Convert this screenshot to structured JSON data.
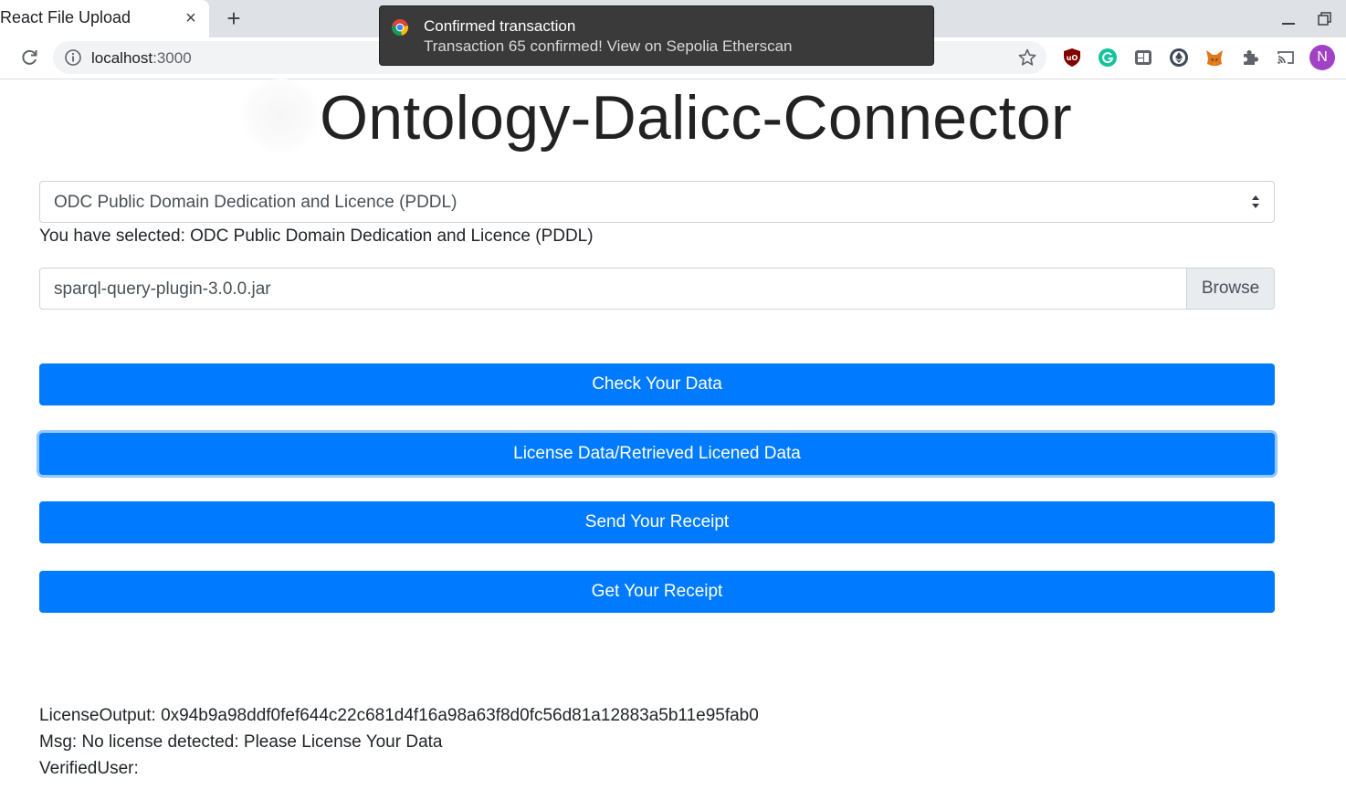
{
  "browser": {
    "tab_title": "React File Upload",
    "tab_close": "×",
    "new_tab": "+",
    "url_host": "localhost",
    "url_port": ":3000",
    "profile_initial": "N",
    "profile_color": "#a142c4",
    "extensions": [
      "ublock-icon",
      "grammarly-icon",
      "extension-icon",
      "ethereum-icon",
      "metamask-icon",
      "puzzle-icon",
      "cast-icon"
    ]
  },
  "toast": {
    "title": "Confirmed transaction",
    "body": "Transaction 65 confirmed! View on Sepolia Etherscan"
  },
  "page": {
    "title": "Ontology-Dalicc-Connector",
    "license_select": {
      "selected": "ODC Public Domain Dedication and Licence (PDDL)"
    },
    "selected_prefix": "You have selected: ",
    "selected_value": "ODC Public Domain Dedication and Licence (PDDL)",
    "file_input": {
      "file_name": "sparql-query-plugin-3.0.0.jar",
      "browse_label": "Browse"
    },
    "buttons": {
      "check": "Check Your Data",
      "license": "License Data/Retrieved Licened Data",
      "send_receipt": "Send Your Receipt",
      "get_receipt": "Get Your Receipt"
    },
    "output": {
      "license_label": "LicenseOutput: ",
      "license_value": "0x94b9a98ddf0fef644c22c681d4f16a98a63f8d0fc56d81a12883a5b11e95fab0",
      "msg_label": "Msg: ",
      "msg_value": "No license detected: Please License Your Data",
      "verified_label": "VerifiedUser: ",
      "verified_value": ""
    },
    "accent_color": "#007bff"
  }
}
